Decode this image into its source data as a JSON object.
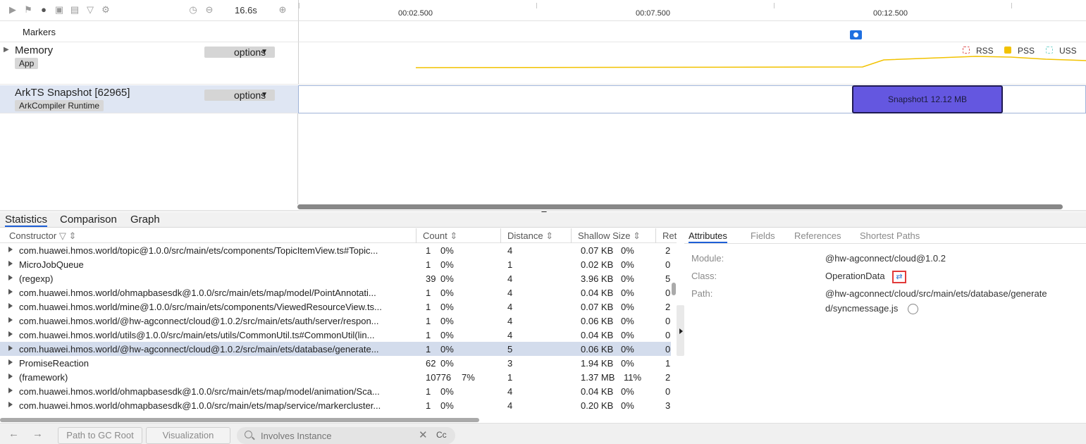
{
  "toolbar": {
    "icons": [
      "play-icon",
      "flag-icon",
      "record-icon",
      "camera-icon",
      "heap-icon",
      "filter-icon",
      "settings-icon",
      "history-icon",
      "zoom-out-icon",
      "zoom-in-icon"
    ],
    "duration": "16.6s"
  },
  "ruler": {
    "ticks": [
      "00:02.500",
      "00:07.500",
      "00:12.500"
    ]
  },
  "lanes": {
    "markers_label": "Markers",
    "memory": {
      "title": "Memory",
      "tag": "App",
      "options": "options"
    },
    "snapshot": {
      "title": "ArkTS Snapshot [62965]",
      "tag": "ArkCompiler Runtime",
      "options": "options"
    }
  },
  "legend": [
    {
      "label": "RSS",
      "color": "#e05a5a"
    },
    {
      "label": "PSS",
      "color": "#f2c200"
    },
    {
      "label": "USS",
      "color": "#7fd6cf"
    }
  ],
  "snapshot_block": {
    "label": "Snapshot1 12.12 MB",
    "color": "#6457e0"
  },
  "bottom_tabs": [
    "Statistics",
    "Comparison",
    "Graph"
  ],
  "table": {
    "columns": [
      "Constructor",
      "Count",
      "Distance",
      "Shallow Size",
      "Ret"
    ],
    "rows": [
      {
        "name": "com.huawei.hmos.world/topic@1.0.0/src/main/ets/components/TopicItemView.ts#Topic...",
        "count": "1",
        "count_pct": "0%",
        "distance": "4",
        "size": "0.07 KB",
        "size_pct": "0%",
        "ret": "2"
      },
      {
        "name": "MicroJobQueue",
        "count": "1",
        "count_pct": "0%",
        "distance": "1",
        "size": "0.02 KB",
        "size_pct": "0%",
        "ret": "0"
      },
      {
        "name": "(regexp)",
        "count": "39",
        "count_pct": "0%",
        "distance": "4",
        "size": "3.96 KB",
        "size_pct": "0%",
        "ret": "5"
      },
      {
        "name": "com.huawei.hmos.world/ohmapbasesdk@1.0.0/src/main/ets/map/model/PointAnnotati...",
        "count": "1",
        "count_pct": "0%",
        "distance": "4",
        "size": "0.04 KB",
        "size_pct": "0%",
        "ret": "0"
      },
      {
        "name": "com.huawei.hmos.world/mine@1.0.0/src/main/ets/components/ViewedResourceView.ts...",
        "count": "1",
        "count_pct": "0%",
        "distance": "4",
        "size": "0.07 KB",
        "size_pct": "0%",
        "ret": "2"
      },
      {
        "name": "com.huawei.hmos.world/@hw-agconnect/cloud@1.0.2/src/main/ets/auth/server/respon...",
        "count": "1",
        "count_pct": "0%",
        "distance": "4",
        "size": "0.06 KB",
        "size_pct": "0%",
        "ret": "0"
      },
      {
        "name": "com.huawei.hmos.world/utils@1.0.0/src/main/ets/utils/CommonUtil.ts#CommonUtil(lin...",
        "count": "1",
        "count_pct": "0%",
        "distance": "4",
        "size": "0.04 KB",
        "size_pct": "0%",
        "ret": "0"
      },
      {
        "name": "com.huawei.hmos.world/@hw-agconnect/cloud@1.0.2/src/main/ets/database/generate...",
        "count": "1",
        "count_pct": "0%",
        "distance": "5",
        "size": "0.06 KB",
        "size_pct": "0%",
        "ret": "0",
        "selected": true
      },
      {
        "name": "PromiseReaction",
        "count": "62",
        "count_pct": "0%",
        "distance": "3",
        "size": "1.94 KB",
        "size_pct": "0%",
        "ret": "1"
      },
      {
        "name": "(framework)",
        "count": "10776",
        "count_pct": "7%",
        "distance": "1",
        "size": "1.37 MB",
        "size_pct": "11%",
        "ret": "2"
      },
      {
        "name": "com.huawei.hmos.world/ohmapbasesdk@1.0.0/src/main/ets/map/model/animation/Sca...",
        "count": "1",
        "count_pct": "0%",
        "distance": "4",
        "size": "0.04 KB",
        "size_pct": "0%",
        "ret": "0"
      },
      {
        "name": "com.huawei.hmos.world/ohmapbasesdk@1.0.0/src/main/ets/map/service/markercluster...",
        "count": "1",
        "count_pct": "0%",
        "distance": "4",
        "size": "0.20 KB",
        "size_pct": "0%",
        "ret": "3"
      }
    ]
  },
  "detail": {
    "tabs": [
      "Attributes",
      "Fields",
      "References",
      "Shortest Paths"
    ],
    "module_key": "Module:",
    "module_val": "@hw-agconnect/cloud@1.0.2",
    "class_key": "Class:",
    "class_val": "OperationData",
    "path_key": "Path:",
    "path_line1": "@hw-agconnect/cloud/src/main/ets/database/generate",
    "path_line2": "d/syncmessage.js"
  },
  "footer": {
    "path_btn": "Path to GC Root",
    "vis_btn": "Visualization",
    "search_placeholder": "Involves Instance",
    "case_label": "Cc"
  }
}
